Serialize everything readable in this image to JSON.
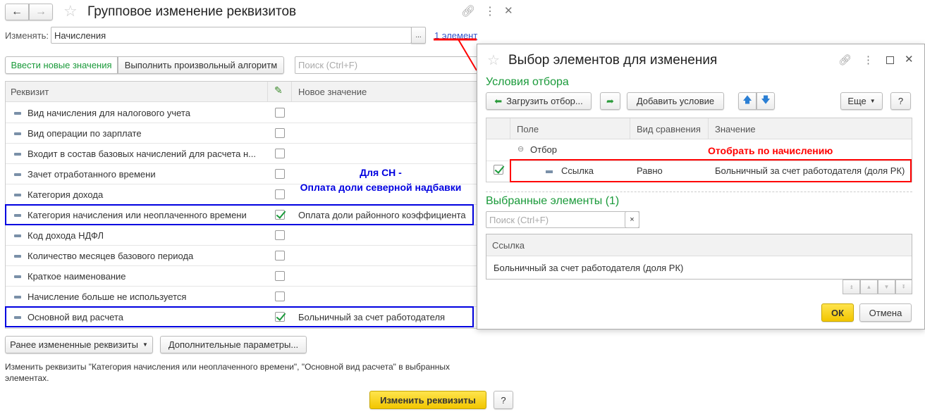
{
  "main": {
    "title": "Групповое изменение реквизитов",
    "change_label": "Изменять:",
    "change_value": "Начисления",
    "ellipsis": "...",
    "elements_link": "1 элемент",
    "tab_new_values": "Ввести новые значения",
    "tab_algorithm": "Выполнить произвольный алгоритм",
    "search_placeholder": "Поиск (Ctrl+F)",
    "columns": {
      "attr": "Реквизит",
      "new_value": "Новое значение"
    },
    "rows": [
      {
        "label": "Вид начисления для налогового учета",
        "checked": false,
        "value": ""
      },
      {
        "label": "Вид операции по зарплате",
        "checked": false,
        "value": ""
      },
      {
        "label": "Входит в состав базовых начислений для расчета н...",
        "checked": false,
        "value": ""
      },
      {
        "label": "Зачет отработанного времени",
        "checked": false,
        "value": ""
      },
      {
        "label": "Категория дохода",
        "checked": false,
        "value": ""
      },
      {
        "label": "Категория начисления или неоплаченного времени",
        "checked": true,
        "value": "Оплата доли районного коэффициента"
      },
      {
        "label": "Код дохода НДФЛ",
        "checked": false,
        "value": ""
      },
      {
        "label": "Количество месяцев базового периода",
        "checked": false,
        "value": ""
      },
      {
        "label": "Краткое наименование",
        "checked": false,
        "value": ""
      },
      {
        "label": "Начисление больше не используется",
        "checked": false,
        "value": ""
      },
      {
        "label": "Основной вид расчета",
        "checked": true,
        "value": "Больничный за счет работодателя"
      }
    ],
    "prev_changed_button": "Ранее измененные реквизиты",
    "extra_params_button": "Дополнительные параметры...",
    "info_text_1": "Изменить реквизиты \"Категория начисления или неоплаченного времени\", \"Основной вид расчета\" в выбранных",
    "info_text_2": "элементах.",
    "apply_button": "Изменить реквизиты",
    "help_button": "?"
  },
  "annotation": {
    "line1": "Для СН -",
    "line2": "Оплата доли северной надбавки",
    "filter_note": "Отобрать по начислению"
  },
  "dialog": {
    "title": "Выбор элементов для изменения",
    "filter_section": "Условия отбора",
    "load_filter_button": "Загрузить отбор...",
    "add_condition_button": "Добавить условие",
    "more_button": "Еще",
    "help_button": "?",
    "filter_columns": {
      "field": "Поле",
      "comparison": "Вид сравнения",
      "value": "Значение"
    },
    "filter_group": "Отбор",
    "filter_row": {
      "field": "Ссылка",
      "comparison": "Равно",
      "value": "Больничный за счет работодателя (доля РК)",
      "checked": true
    },
    "selected_section": "Выбранные элементы (1)",
    "search_placeholder": "Поиск (Ctrl+F)",
    "clear": "×",
    "selected_column": "Ссылка",
    "selected_items": [
      "Больничный за счет работодателя (доля РК)"
    ],
    "ok_button": "ОК",
    "cancel_button": "Отмена"
  },
  "colors": {
    "accent_green": "#1a9a3a",
    "annotation_blue": "#0000e0",
    "annotation_red": "#ff0000",
    "primary_yellow": "#f2c600"
  }
}
